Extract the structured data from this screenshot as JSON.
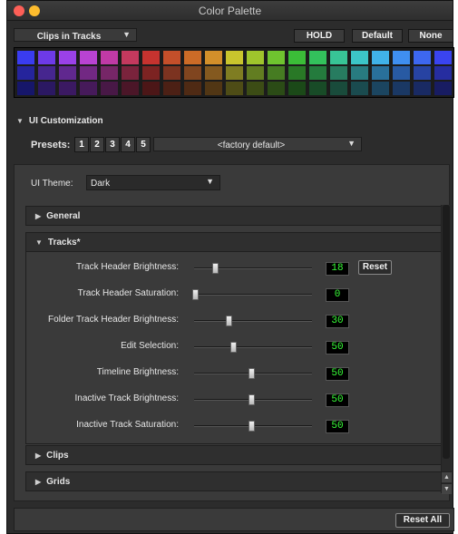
{
  "window": {
    "title": "Color Palette"
  },
  "toolbar": {
    "clips_dropdown": "Clips in Tracks",
    "hold_label": "HOLD",
    "default_label": "Default",
    "none_label": "None"
  },
  "palette": {
    "rows": [
      [
        "#3a3cf0",
        "#6d3ae8",
        "#9a41e8",
        "#b943d2",
        "#c03aa6",
        "#c4395e",
        "#c6332f",
        "#c44f2a",
        "#cc6b27",
        "#d38f2a",
        "#c9c52d",
        "#9fc52c",
        "#6fc42f",
        "#3bbd38",
        "#33c15c",
        "#38c496",
        "#3cc5c7",
        "#40b2e8",
        "#3f8ff0",
        "#3d67f0",
        "#3a44f0"
      ],
      [
        "#25249c",
        "#46268f",
        "#60288f",
        "#722883",
        "#762667",
        "#7a233c",
        "#7c2322",
        "#7c3320",
        "#80451f",
        "#84591f",
        "#7f7d22",
        "#627d21",
        "#467c22",
        "#297826",
        "#247b3d",
        "#277c60",
        "#287b80",
        "#29709a",
        "#285aa3",
        "#2743a2",
        "#262da0"
      ],
      [
        "#16166a",
        "#2b1862",
        "#3b1962",
        "#461a5a",
        "#481846",
        "#4b1628",
        "#4c1617",
        "#4c2015",
        "#4f2a14",
        "#513614",
        "#4e4c16",
        "#3c4c15",
        "#2b4b16",
        "#1b4918",
        "#184b27",
        "#194b3b",
        "#1a4b4f",
        "#1b4560",
        "#1a3864",
        "#192a63",
        "#181c62"
      ]
    ]
  },
  "customization": {
    "title": "UI Customization",
    "presets_label": "Presets:",
    "presets": [
      "1",
      "2",
      "3",
      "4",
      "5"
    ],
    "preset_dropdown": "<factory default>"
  },
  "theme": {
    "label": "UI Theme:",
    "value": "Dark"
  },
  "groups": {
    "general": "General",
    "tracks": "Tracks*",
    "clips": "Clips",
    "grids": "Grids"
  },
  "tracks_settings": [
    {
      "label": "Track Header Brightness:",
      "value": "18",
      "fraction": 0.18
    },
    {
      "label": "Track Header Saturation:",
      "value": "0",
      "fraction": 0.0
    },
    {
      "label": "Folder Track Header Brightness:",
      "value": "30",
      "fraction": 0.3
    },
    {
      "label": "Edit Selection:",
      "value": "50",
      "fraction": 0.34
    },
    {
      "label": "Timeline Brightness:",
      "value": "50",
      "fraction": 0.5
    },
    {
      "label": "Inactive Track Brightness:",
      "value": "50",
      "fraction": 0.5
    },
    {
      "label": "Inactive Track Saturation:",
      "value": "50",
      "fraction": 0.5
    }
  ],
  "reset_label": "Reset",
  "reset_all_label": "Reset All"
}
